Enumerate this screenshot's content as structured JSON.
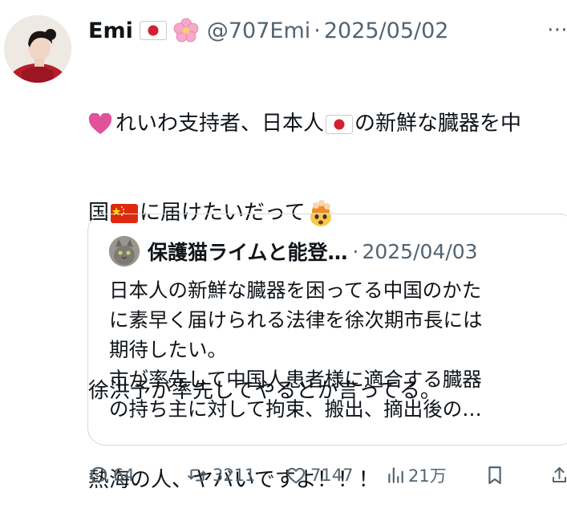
{
  "tweet": {
    "author_name": "Emi",
    "handle": "@707Emi",
    "separator": "·",
    "date": "2025/05/02",
    "more_label": "⋯",
    "lines": [
      {
        "text": "れいわ支持者、日本人",
        "after": "の新鮮な臓器を中"
      },
      {
        "text": "国",
        "after": "に届けたいだって"
      },
      {
        "text": ""
      },
      {
        "text": "徐洪予が率先してやるとか言ってる。"
      },
      {
        "text": "熱海の人、ヤバいですよ！！！"
      }
    ]
  },
  "quote": {
    "author_name": "保護猫ライムと能登…",
    "separator": "·",
    "date": "2025/04/03",
    "lines": [
      "日本人の新鮮な臓器を困ってる中国のかた",
      "に素早く届けられる法律を徐次期市長には",
      "期待したい。",
      "市が率先して中国人患者様に適合する臓器",
      "の持ち主に対して拘束、搬出、摘出後の…"
    ]
  },
  "actions": {
    "replies": "64",
    "reposts": "3211",
    "likes": "7147",
    "views": "21万"
  },
  "icons": {
    "reply": "reply-icon",
    "repost": "repost-icon",
    "like": "heart-icon",
    "views": "views-icon",
    "bookmark": "bookmark-icon",
    "share": "share-icon"
  },
  "colors": {
    "secondary_text": "#536471",
    "border": "#cfd9de",
    "heart_emoji": "#e0529c"
  }
}
